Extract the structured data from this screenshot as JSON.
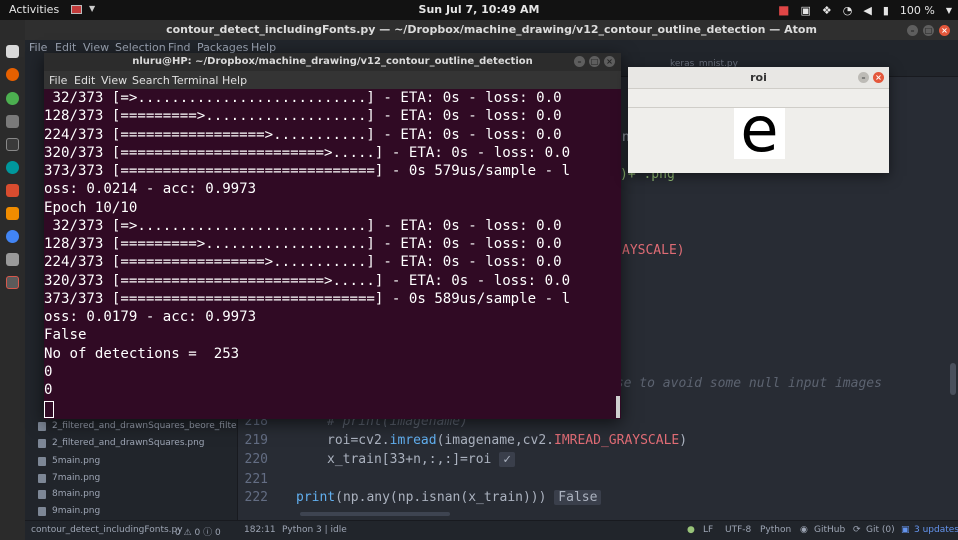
{
  "topbar": {
    "activities": "Activities",
    "clock": "Sun Jul  7, 10:49 AM",
    "battery": "100 %"
  },
  "atom": {
    "title": "contour_detect_includingFonts.py — ~/Dropbox/machine_drawing/v12_contour_outline_detection — Atom",
    "menu": [
      "File",
      "Edit",
      "View",
      "Selection",
      "Find",
      "Packages",
      "Help"
    ],
    "tab_hidden": "keras_mnist.py",
    "tree_items": [
      "2_filtered_and_drawnSquares_beore_filte",
      "2_filtered_and_drawnSquares.png",
      "5main.png",
      "7main.png",
      "8main.png",
      "9main.png"
    ],
    "line_numbers": [
      "218",
      "219",
      "220",
      "221",
      "222"
    ],
    "code": {
      "l218": "# print(imagename)",
      "l219_pre": "roi=cv2.",
      "l219_fn": "imread",
      "l219_mid": "(imagename,cv2.",
      "l219_cst": "IMREAD_GRAYSCALE",
      "l219_post": ")",
      "l220": "x_train[33+n,:,:]=roi",
      "l220_result": "✓",
      "l222_fn": "print",
      "l222_rest": "(np.any(np.isnan(x_train)))",
      "l222_result": "False"
    },
    "ghost": {
      "g1": "nd",
      "g2": ")+'.png'",
      "g3": "AYSCALE)",
      "g4": "use to avoid some null input images",
      "g5": "s 579us/sample - l",
      "g6": "- acc: 0.9973",
      "g7": "0s 589us/sample - l",
      "g8": "of detections =  253"
    },
    "status": {
      "file": "contour_detect_includingFonts.py",
      "diagnostics": "0 ⚠ 0 ⓘ 0",
      "cursor": "182:11",
      "kernel": "Python 3 | idle",
      "line_ending": "LF",
      "encoding": "UTF-8",
      "grammar": "Python",
      "github": "GitHub",
      "git": "Git (0)",
      "updates": "3 updates"
    }
  },
  "terminal": {
    "title": "nluru@HP: ~/Dropbox/machine_drawing/v12_contour_outline_detection",
    "menu": [
      "File",
      "Edit",
      "View",
      "Search",
      "Terminal",
      "Help"
    ],
    "lines": [
      " 32/373 [=>...........................] - ETA: 0s - loss: 0.0",
      "128/373 [=========>...................] - ETA: 0s - loss: 0.0",
      "224/373 [=================>...........] - ETA: 0s - loss: 0.0",
      "320/373 [========================>.....] - ETA: 0s - loss: 0.0",
      "373/373 [==============================] - 0s 579us/sample - l",
      "oss: 0.0214 - acc: 0.9973",
      "Epoch 10/10",
      " 32/373 [=>...........................] - ETA: 0s - loss: 0.0",
      "128/373 [=========>...................] - ETA: 0s - loss: 0.0",
      "224/373 [=================>...........] - ETA: 0s - loss: 0.0",
      "320/373 [========================>.....] - ETA: 0s - loss: 0.0",
      "373/373 [==============================] - 0s 589us/sample - l",
      "oss: 0.0179 - acc: 0.9973",
      "False",
      "No of detections =  253",
      "0",
      "0"
    ]
  },
  "roi": {
    "title": "roi",
    "character": "e"
  }
}
